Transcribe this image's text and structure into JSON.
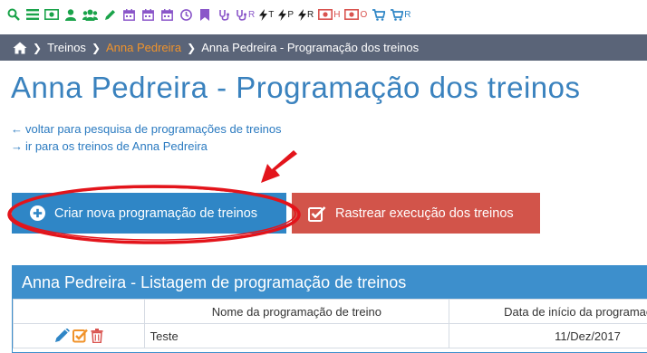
{
  "toolbar": {
    "items": [
      {
        "name": "search-icon",
        "label": ""
      },
      {
        "name": "menu-icon",
        "label": ""
      },
      {
        "name": "money-icon",
        "label": ""
      },
      {
        "name": "user-icon",
        "label": ""
      },
      {
        "name": "users-icon",
        "label": ""
      },
      {
        "name": "pencil-icon",
        "label": ""
      },
      {
        "name": "calendar-icon",
        "label": ""
      },
      {
        "name": "calendar-icon",
        "label": ""
      },
      {
        "name": "calendar-icon",
        "label": ""
      },
      {
        "name": "clock-icon",
        "label": ""
      },
      {
        "name": "bookmark-icon",
        "label": ""
      },
      {
        "name": "stethoscope-icon",
        "label": ""
      },
      {
        "name": "stethoscope-icon",
        "label": "R"
      },
      {
        "name": "bolt-icon",
        "label": "T"
      },
      {
        "name": "bolt-icon",
        "label": "P"
      },
      {
        "name": "bolt-icon",
        "label": "R"
      },
      {
        "name": "money-icon",
        "label": "H"
      },
      {
        "name": "money-icon",
        "label": "O"
      },
      {
        "name": "cart-icon",
        "label": ""
      },
      {
        "name": "cart-icon",
        "label": "R"
      }
    ],
    "accent": "#1aa34a",
    "purple_accent": "#8a56c9",
    "red_accent": "#d9534f"
  },
  "breadcrumb": {
    "items": [
      "Treinos",
      "Anna Pedreira",
      "Anna Pedreira - Programação dos treinos"
    ]
  },
  "page": {
    "title": "Anna Pedreira - Programação dos treinos",
    "link_back": "voltar para pesquisa de programações de treinos",
    "link_trainings": "ir para os treinos de Anna Pedreira"
  },
  "buttons": {
    "create": "Criar nova programação de treinos",
    "track": "Rastrear execução dos treinos"
  },
  "panel": {
    "title": "Anna Pedreira - Listagem de programação de treinos",
    "columns": [
      "",
      "Nome da programação de treino",
      "Data de início da programação"
    ],
    "rows": [
      {
        "name": "Teste",
        "date": "11/Dez/2017"
      }
    ]
  },
  "colors": {
    "title_blue": "#3a82be",
    "breadcrumb_bg": "#5a6478",
    "breadcrumb_active": "#f0932b",
    "btn_create": "#2f86c6",
    "btn_track": "#d2544a",
    "annotation_red": "#e3141b"
  }
}
